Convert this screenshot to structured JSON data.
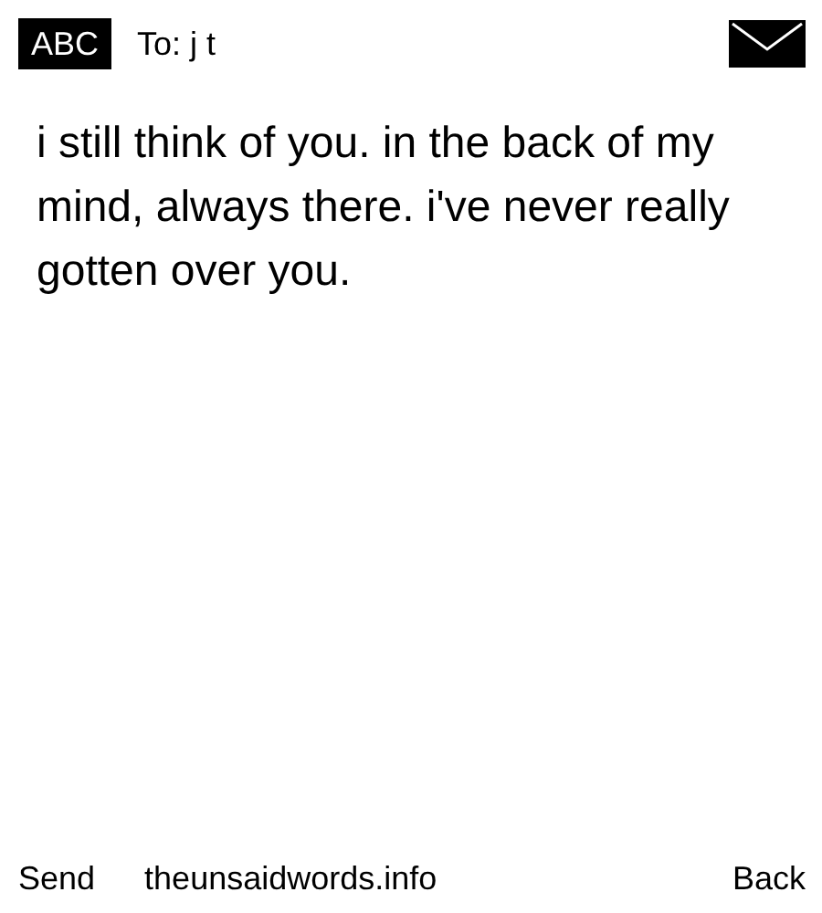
{
  "header": {
    "input_mode": "ABC",
    "recipient": "To: j t"
  },
  "message": "i still think of you. in the back of my mind, always there. i've never really gotten over you.",
  "softkeys": {
    "left": "Send",
    "center": "theunsaidwords.info",
    "right": "Back"
  }
}
